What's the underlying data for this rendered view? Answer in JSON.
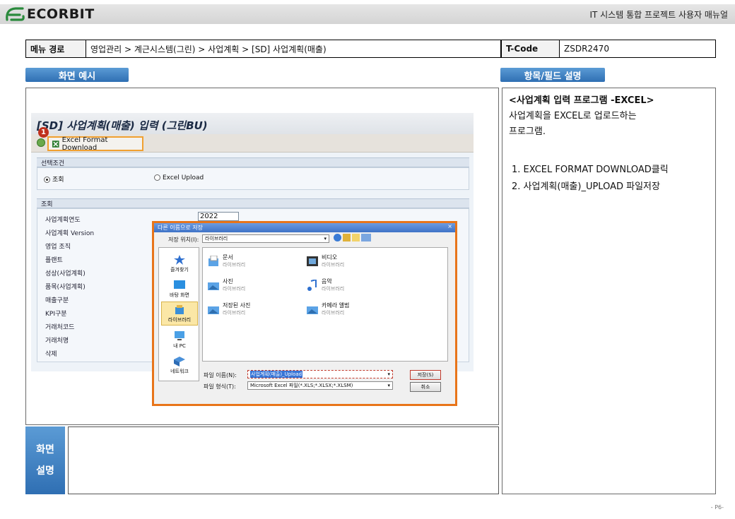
{
  "header": {
    "logo_text": "ECORBIT",
    "manual_title": "IT 시스템 통합 프로젝트 사용자 매뉴얼"
  },
  "path_table": {
    "menu_label": "메뉴 경로",
    "menu_path": "영업관리 > 계근시스템(그린) > 사업계획 > [SD] 사업계획(매출)",
    "tcode_label": "T-Code",
    "tcode_value": "ZSDR2470"
  },
  "sections": {
    "screen_example": "화면 예시",
    "field_desc": "항목/필드 설명",
    "screen_desc_line1": "화면",
    "screen_desc_line2": "설명"
  },
  "sap": {
    "title": "[SD] 사업계획(매출) 입력 (그린BU)",
    "step_badge": "1",
    "excel_button": "Excel Format Download",
    "group1_title": "선택조건",
    "radio_query": "조회",
    "radio_upload": "Excel Upload",
    "group2_title": "조회",
    "fields": [
      "사업계획연도",
      "사업계획 Version",
      "영업 조직",
      "플랜트",
      "성상(사업계획)",
      "품목(사업계획)",
      "매출구분",
      "KPI구분",
      "거래처코드",
      "거래처명",
      "삭제"
    ],
    "year_value": "2022"
  },
  "dialog": {
    "title": "다른 이름으로 저장",
    "close": "×",
    "location_label": "저장 위치(I):",
    "location_value": "라이브러리",
    "places": [
      "즐겨찾기",
      "바탕 화면",
      "라이브러리",
      "내 PC",
      "네트워크"
    ],
    "files": [
      {
        "name": "문서",
        "sub": "라이브러리"
      },
      {
        "name": "비디오",
        "sub": "라이브러리"
      },
      {
        "name": "사진",
        "sub": "라이브러리"
      },
      {
        "name": "음악",
        "sub": "라이브러리"
      },
      {
        "name": "저장된 사진",
        "sub": "라이브러리"
      },
      {
        "name": "카메라 앨범",
        "sub": "라이브러리"
      }
    ],
    "filename_label": "파일 이름(N):",
    "filename_value": "사업계획(매출)_Upload",
    "filetype_label": "파일 형식(T):",
    "filetype_value": "Microsoft Excel 파일(*.XLS;*.XLSX;*.XLSM)",
    "save_button": "저장(S)",
    "cancel_button": "취소"
  },
  "right_panel": {
    "heading": "<사업계획 입력 프로그램 -EXCEL>",
    "desc1": "사업계획을 EXCEL로 업로드하는",
    "desc2": "프로그램.",
    "steps": [
      "1.  EXCEL FORMAT DOWNLOAD클릭",
      "2.  사업계획(매출)_UPLOAD 파일저장"
    ]
  },
  "page_number": "- P6-",
  "colors": {
    "accent_blue": "#2f6fb3",
    "highlight_orange": "#e8751a",
    "badge_red": "#c0311d"
  }
}
